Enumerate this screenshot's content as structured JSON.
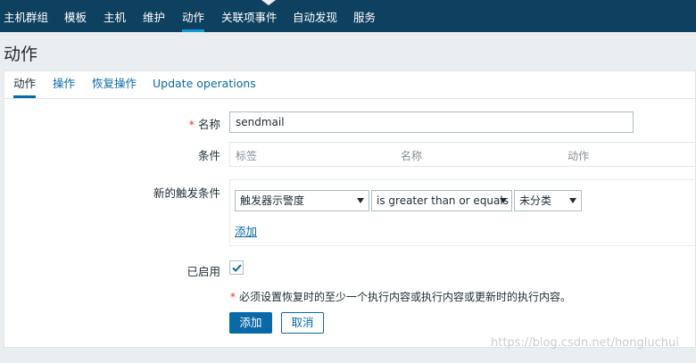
{
  "topnav": {
    "items": [
      {
        "label": "主机群组"
      },
      {
        "label": "模板"
      },
      {
        "label": "主机"
      },
      {
        "label": "维护"
      },
      {
        "label": "动作"
      },
      {
        "label": "关联项事件"
      },
      {
        "label": "自动发现"
      },
      {
        "label": "服务"
      }
    ],
    "active_index": 4
  },
  "page": {
    "title": "动作"
  },
  "tabs": [
    {
      "label": "动作"
    },
    {
      "label": "操作"
    },
    {
      "label": "恢复操作"
    },
    {
      "label": "Update operations"
    }
  ],
  "form": {
    "name": {
      "required_mark": "*",
      "label": "名称",
      "value": "sendmail"
    },
    "conditions": {
      "label": "条件",
      "columns": [
        "标签",
        "名称",
        "动作"
      ]
    },
    "new_condition": {
      "label": "新的触发条件",
      "type_select": "触发器示警度",
      "operator_select": "is greater than or equals",
      "value_select": "未分类",
      "add_link": "添加"
    },
    "enabled": {
      "label": "已启用",
      "checked": true
    },
    "notice": {
      "mark": "*",
      "text": "必须设置恢复时的至少一个执行内容或执行内容或更新时的执行内容。"
    },
    "buttons": {
      "add": "添加",
      "cancel": "取消"
    }
  },
  "watermark": "https://blog.csdn.net/hongluchui",
  "colors": {
    "nav_bg": "#0e4160",
    "accent": "#0a6aa8",
    "required": "#e33734"
  }
}
